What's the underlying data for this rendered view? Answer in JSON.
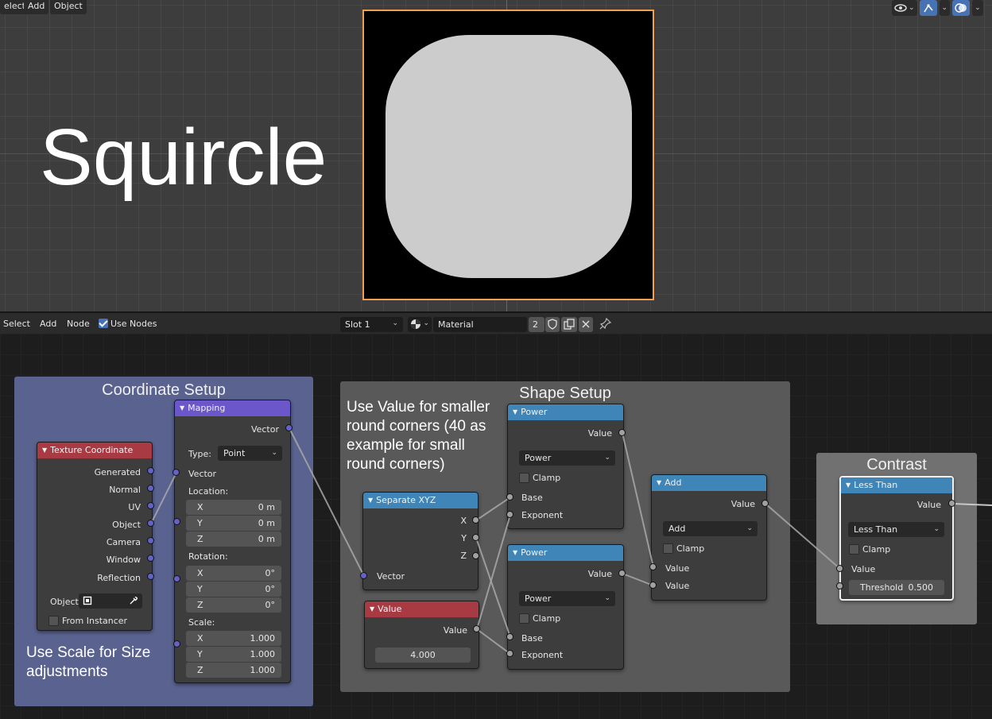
{
  "viewport": {
    "menu": [
      "elect",
      "Add",
      "Object"
    ],
    "title_text": "Squircle"
  },
  "node_header": {
    "menu": [
      "Select",
      "Add",
      "Node"
    ],
    "use_nodes_label": "Use Nodes",
    "slot": "Slot 1",
    "material": "Material",
    "users": "2"
  },
  "frames": {
    "coordinate": {
      "title": "Coordinate Setup",
      "note": "Use Scale for Size adjustments",
      "color": "#5a6390"
    },
    "shape": {
      "title": "Shape Setup",
      "note": "Use Value for smaller round corners (40 as example for small round corners)",
      "color": "#595959"
    },
    "contrast": {
      "title": "Contrast",
      "color": "#717171"
    }
  },
  "nodes": {
    "texcoord": {
      "title": "Texture Coordinate",
      "outputs": [
        "Generated",
        "Normal",
        "UV",
        "Object",
        "Camera",
        "Window",
        "Reflection"
      ],
      "object_label": "Object:",
      "from_instancer": "From Instancer"
    },
    "mapping": {
      "title": "Mapping",
      "output": "Vector",
      "type_label": "Type:",
      "type_value": "Point",
      "input_vector": "Vector",
      "location_label": "Location:",
      "location": [
        {
          "axis": "X",
          "value": "0 m"
        },
        {
          "axis": "Y",
          "value": "0 m"
        },
        {
          "axis": "Z",
          "value": "0 m"
        }
      ],
      "rotation_label": "Rotation:",
      "rotation": [
        {
          "axis": "X",
          "value": "0°"
        },
        {
          "axis": "Y",
          "value": "0°"
        },
        {
          "axis": "Z",
          "value": "0°"
        }
      ],
      "scale_label": "Scale:",
      "scale": [
        {
          "axis": "X",
          "value": "1.000"
        },
        {
          "axis": "Y",
          "value": "1.000"
        },
        {
          "axis": "Z",
          "value": "1.000"
        }
      ]
    },
    "separate": {
      "title": "Separate XYZ",
      "outputs": [
        "X",
        "Y",
        "Z"
      ],
      "input": "Vector"
    },
    "value": {
      "title": "Value",
      "output": "Value",
      "value": "4.000"
    },
    "power1": {
      "title": "Power",
      "output": "Value",
      "op": "Power",
      "clamp": "Clamp",
      "inputs": [
        "Base",
        "Exponent"
      ]
    },
    "power2": {
      "title": "Power",
      "output": "Value",
      "op": "Power",
      "clamp": "Clamp",
      "inputs": [
        "Base",
        "Exponent"
      ]
    },
    "add": {
      "title": "Add",
      "output": "Value",
      "op": "Add",
      "clamp": "Clamp",
      "inputs": [
        "Value",
        "Value"
      ]
    },
    "lessthan": {
      "title": "Less Than",
      "output": "Value",
      "op": "Less Than",
      "clamp": "Clamp",
      "input": "Value",
      "threshold_label": "Threshold",
      "threshold_value": "0.500"
    }
  },
  "colors": {
    "accent": "#4772b3",
    "selection": "#f0a052",
    "vector_socket": "#6363c7",
    "float_socket": "#a1a1a1"
  }
}
